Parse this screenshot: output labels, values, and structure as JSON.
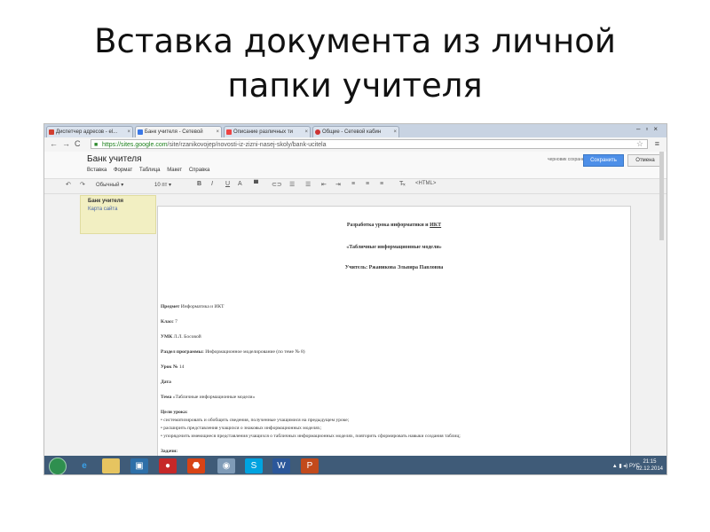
{
  "slide": {
    "title_line1": "Вставка документа из личной",
    "title_line2": "папки учителя"
  },
  "browser": {
    "tabs": [
      {
        "label": "Диспетчер адресов - el..."
      },
      {
        "label": "Банк учителя - Сетевой"
      },
      {
        "label": "Описание различных ти"
      },
      {
        "label": "Общие - Сетевой кабин"
      }
    ],
    "url_host": "https://sites.google.com",
    "url_path": "/site/rzanikovojep/novosti-iz-zizni-nasej-skoly/bank-ucitela"
  },
  "site": {
    "name": "Банк учителя",
    "menu": [
      "Вставка",
      "Формат",
      "Таблица",
      "Макет",
      "Справка"
    ],
    "saved_text": "черновик сохранен в 3:15",
    "save_label": "Сохранить",
    "cancel_label": "Отмена"
  },
  "toolbar": {
    "style_select": "Обычный",
    "size_select": "10 пт",
    "html_label": "<HTML>"
  },
  "sidebar": {
    "item1": "Банк учителя",
    "item2": "Карта сайта"
  },
  "doc": {
    "h1a": "Разработка урока информатики и ",
    "h1b": "ИКТ",
    "h2": "«Табличные информационные модели»",
    "h3": "Учитель: Ржаникова Эльвира Павловна",
    "l1a": "Предмет",
    "l1b": " Информатика и ИКТ",
    "l2a": "Класс",
    "l2b": " 7",
    "l3a": "УМК",
    "l3b": " Л.Л. Босовой",
    "l4a": "Раздел программы:",
    "l4b": " Информационное моделирование (по теме № 8)",
    "l5a": "Урок №",
    "l5b": " 14",
    "l6a": "Дата",
    "l7a": "Тема",
    "l7b": " «Табличные информационные модели»",
    "l8a": "Цели урока:",
    "l9": "• систематизировать и обобщить сведения, полученные учащимися на предыдущем уроке;",
    "l10": "• расширить представления учащихся о знаковых информационных моделях;",
    "l11": "• упорядочить имеющиеся представления учащихся о табличных информационных моделях, повторить сформировать навыки создания таблиц;",
    "l12a": "Задачи:"
  },
  "taskbar": {
    "lang": "РУС",
    "time": "21:15",
    "date": "02.12.2014"
  }
}
